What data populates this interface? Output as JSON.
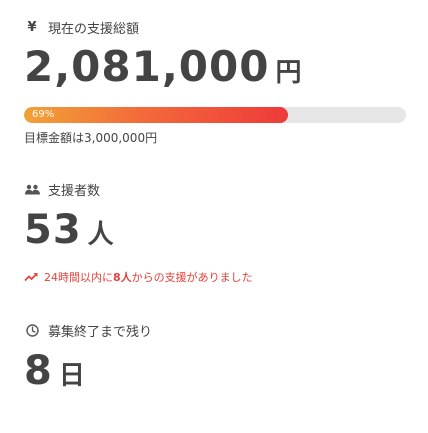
{
  "funding": {
    "label": "現在の支援総額",
    "amount": "2,081,000",
    "unit": "円",
    "progress_text": "69%",
    "progress_fraction": 0.69,
    "goal_text": "目標金額は3,000,000円"
  },
  "supporters": {
    "label": "支援者数",
    "count": "53",
    "unit": "人",
    "recent_prefix": "24時間以内に",
    "recent_count": "8人",
    "recent_suffix": "からの支援がありました"
  },
  "deadline": {
    "label": "募集終了まで残り",
    "count": "8",
    "unit": "日"
  },
  "colors": {
    "progress_start": "#f2a236",
    "progress_end": "#ee3a3a",
    "track": "#e6e6e6",
    "alert": "#e8413a",
    "text": "#444444"
  },
  "icons": {
    "funding": "yen-icon",
    "supporters": "people-icon",
    "recent": "trend-up-icon",
    "deadline": "clock-icon"
  }
}
